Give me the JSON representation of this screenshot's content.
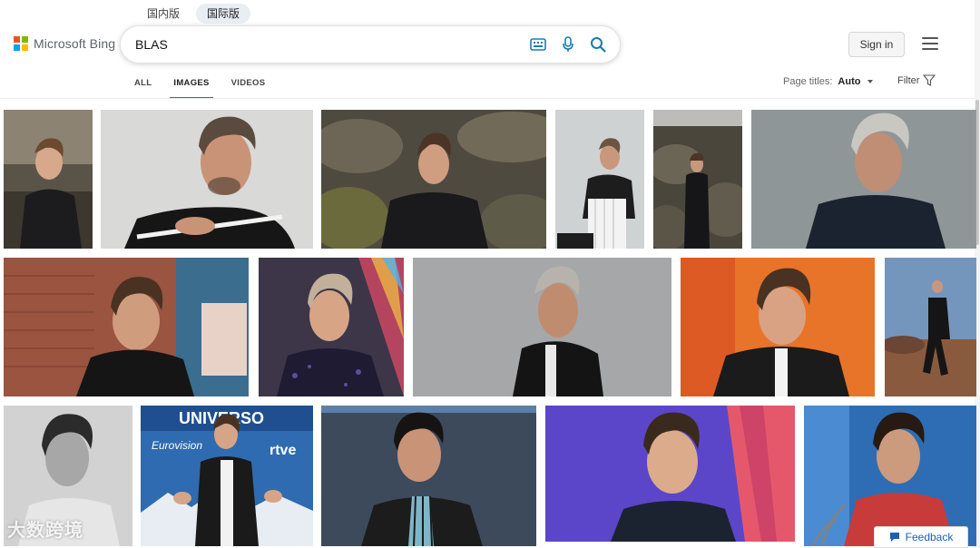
{
  "region_tabs": [
    {
      "label": "国内版",
      "active": false
    },
    {
      "label": "国际版",
      "active": true
    }
  ],
  "logo": {
    "text": "Microsoft Bing",
    "colors": [
      "#f25022",
      "#7fba00",
      "#00a4ef",
      "#ffb900"
    ]
  },
  "search": {
    "value": "BLAS",
    "icons": [
      "visual-search-icon",
      "microphone-icon",
      "search-icon"
    ]
  },
  "header": {
    "signin_label": "Sign in"
  },
  "scopes": [
    {
      "label": "ALL",
      "active": false
    },
    {
      "label": "IMAGES",
      "active": true
    },
    {
      "label": "VIDEOS",
      "active": false
    }
  ],
  "page_titles": {
    "label": "Page titles:",
    "value": "Auto"
  },
  "filter_label": "Filter",
  "accent_color": "#1a7bb0",
  "images": [
    {
      "row": 1,
      "scene": "dark-jacket-outdoor"
    },
    {
      "row": 1,
      "scene": "grey-studio-sweater"
    },
    {
      "row": 1,
      "scene": "volcanic-rocks-portrait"
    },
    {
      "row": 1,
      "scene": "white-chair-sitting"
    },
    {
      "row": 1,
      "scene": "volcanic-rocks-full"
    },
    {
      "row": 1,
      "scene": "grey-studio-jacket"
    },
    {
      "row": 2,
      "scene": "brick-wall-shop"
    },
    {
      "row": 2,
      "scene": "sequin-jacket-red-carpet"
    },
    {
      "row": 2,
      "scene": "grey-studio-profile"
    },
    {
      "row": 2,
      "scene": "orange-background"
    },
    {
      "row": 2,
      "scene": "desert-walking"
    },
    {
      "row": 3,
      "scene": "black-white-portrait"
    },
    {
      "row": 3,
      "scene": "eurovision-press"
    },
    {
      "row": 3,
      "scene": "purple-studio"
    },
    {
      "row": 3,
      "scene": "neon-stage"
    },
    {
      "row": 3,
      "scene": "blue-wall-outdoor"
    }
  ],
  "banner_texts": {
    "universo": "UNIVERSO",
    "eurovision": "Eurovision",
    "rtve": "rtve"
  },
  "watermark_text": "大数跨境",
  "feedback_label": "Feedback"
}
